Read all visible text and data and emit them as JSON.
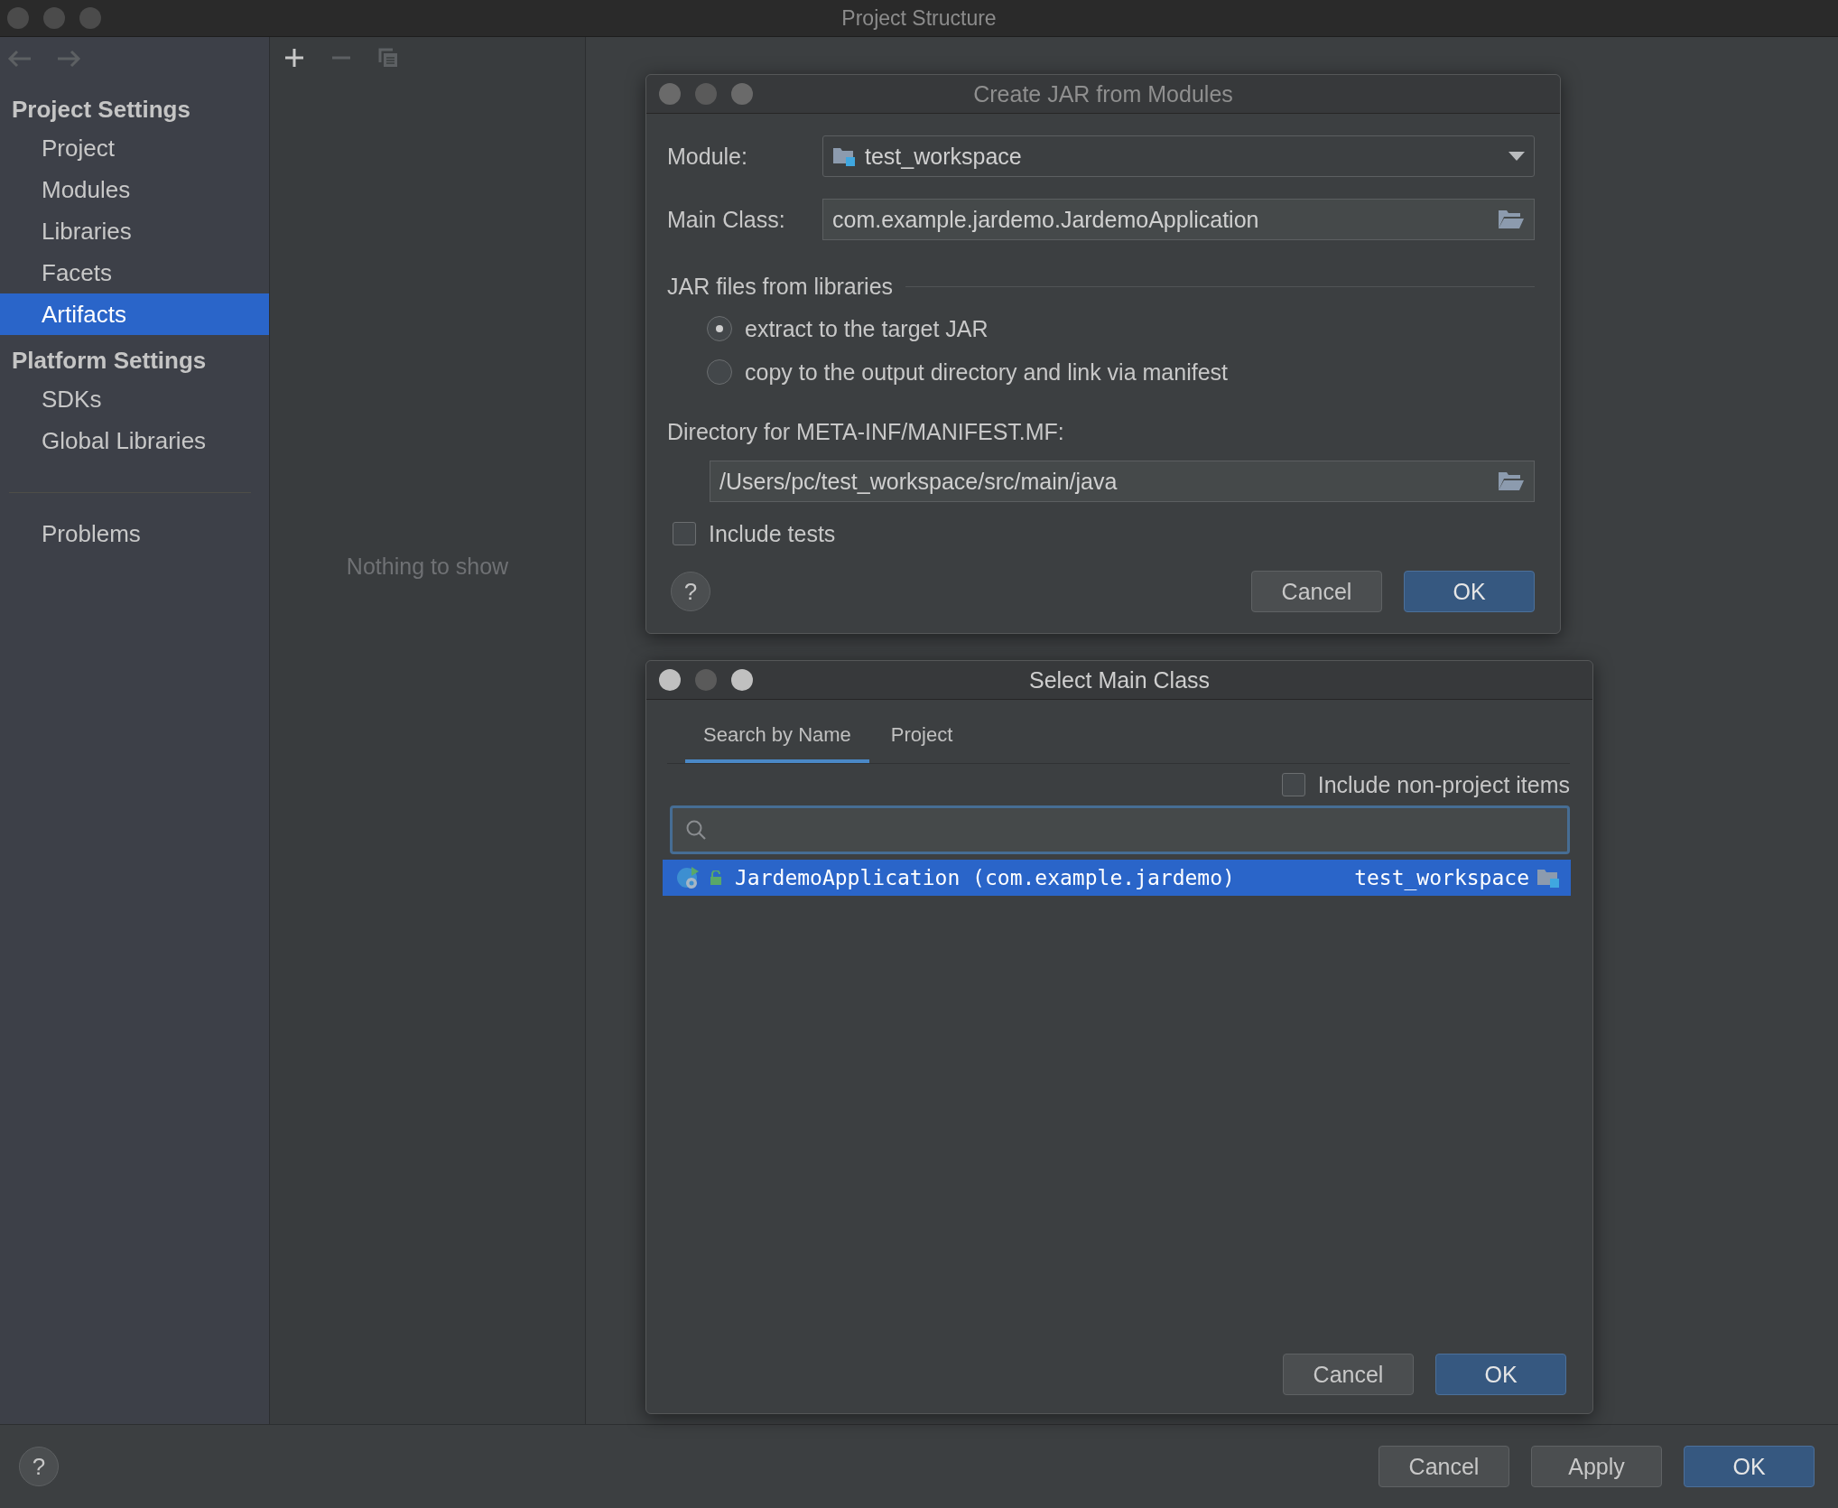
{
  "window": {
    "title": "Project Structure"
  },
  "sidebar": {
    "sections": [
      {
        "heading": "Project Settings",
        "items": [
          {
            "label": "Project",
            "selected": false
          },
          {
            "label": "Modules",
            "selected": false
          },
          {
            "label": "Libraries",
            "selected": false
          },
          {
            "label": "Facets",
            "selected": false
          },
          {
            "label": "Artifacts",
            "selected": true
          }
        ]
      },
      {
        "heading": "Platform Settings",
        "items": [
          {
            "label": "SDKs",
            "selected": false
          },
          {
            "label": "Global Libraries",
            "selected": false
          }
        ]
      }
    ],
    "problems": {
      "label": "Problems",
      "selected": false
    }
  },
  "middle_panel": {
    "empty_text": "Nothing to show"
  },
  "footer": {
    "help": "?",
    "buttons": [
      {
        "label": "Cancel",
        "kind": "secondary"
      },
      {
        "label": "Apply",
        "kind": "secondary"
      },
      {
        "label": "OK",
        "kind": "primary"
      }
    ]
  },
  "jar_dialog": {
    "title": "Create JAR from Modules",
    "module_label": "Module:",
    "module_value": "test_workspace",
    "main_class_label": "Main Class:",
    "main_class_value": "com.example.jardemo.JardemoApplication",
    "libraries_heading": "JAR files from libraries",
    "options": [
      {
        "label": "extract to the target JAR",
        "selected": true
      },
      {
        "label": "copy to the output directory and link via manifest",
        "selected": false
      }
    ],
    "manifest_label": "Directory for META-INF/MANIFEST.MF:",
    "manifest_value": "/Users/pc/test_workspace/src/main/java",
    "include_tests": {
      "label": "Include tests",
      "checked": false
    },
    "help": "?",
    "buttons": [
      {
        "label": "Cancel",
        "kind": "secondary"
      },
      {
        "label": "OK",
        "kind": "primary"
      }
    ]
  },
  "main_class_dialog": {
    "title": "Select Main Class",
    "tabs": [
      {
        "label": "Search by Name",
        "selected": true
      },
      {
        "label": "Project",
        "selected": false
      }
    ],
    "include_non_project": {
      "label": "Include non-project items",
      "checked": false
    },
    "results": [
      {
        "name": "JardemoApplication (com.example.jardemo)",
        "module": "test_workspace",
        "selected": true
      }
    ],
    "buttons": [
      {
        "label": "Cancel",
        "kind": "secondary"
      },
      {
        "label": "OK",
        "kind": "primary"
      }
    ]
  }
}
